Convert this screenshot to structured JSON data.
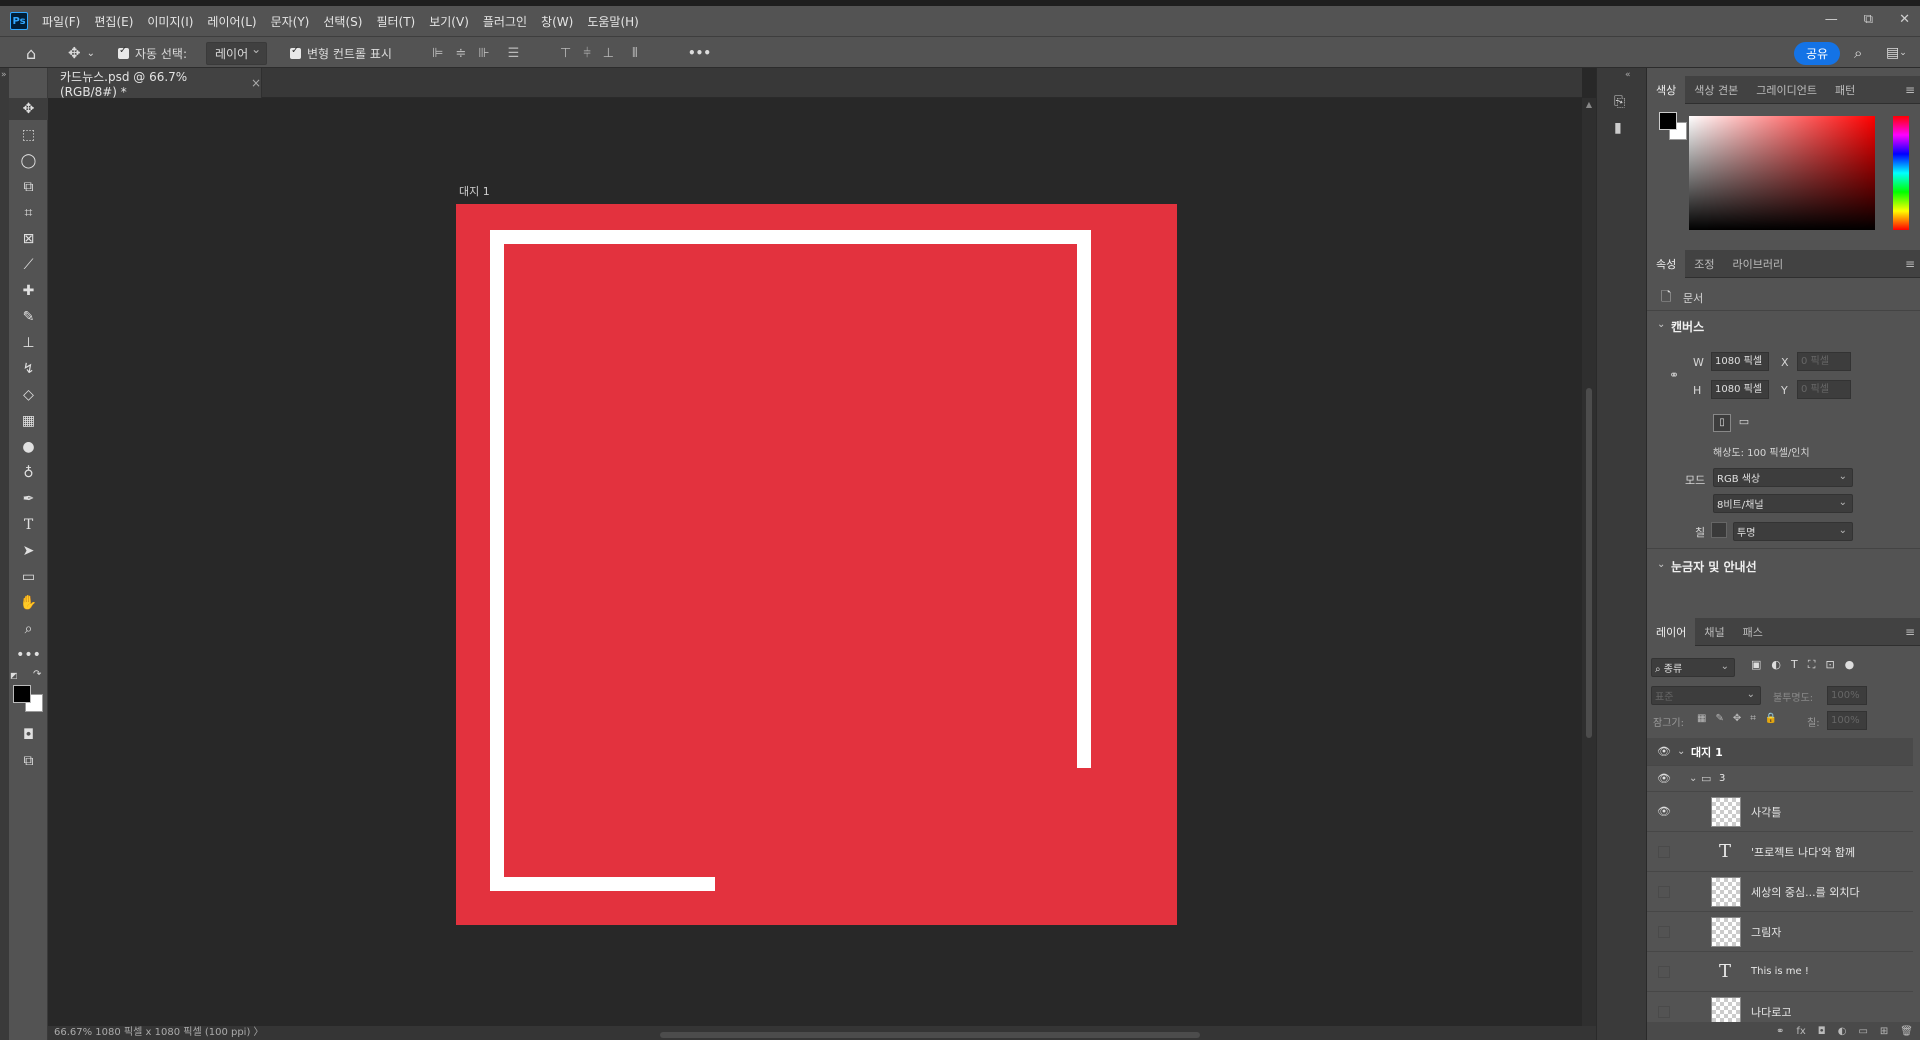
{
  "app": {
    "logo": "Ps"
  },
  "menu": [
    "파일(F)",
    "편집(E)",
    "이미지(I)",
    "레이어(L)",
    "문자(Y)",
    "선택(S)",
    "필터(T)",
    "보기(V)",
    "플러그인",
    "창(W)",
    "도움말(H)"
  ],
  "window_controls": [
    "—",
    "⧉",
    "✕"
  ],
  "options": {
    "auto_select_label": "자동 선택:",
    "auto_select_value": "레이어",
    "transform_label": "변형 컨트롤 표시",
    "more": "•••",
    "share": "공유"
  },
  "document": {
    "tab_title": "카드뉴스.psd @ 66.7% (RGB/8#) *",
    "tab_close": "×",
    "artboard_name": "대지 1",
    "artboard_color": "#e3323e",
    "status": "66.67%    1080 픽셀 x 1080 픽셀 (100 ppi)   〉"
  },
  "color_panel": {
    "tabs": [
      "색상",
      "색상 견본",
      "그레이디언트",
      "패턴"
    ],
    "hue_color": "#ff0000"
  },
  "properties_panel": {
    "tabs": [
      "속성",
      "조정",
      "라이브러리"
    ],
    "doc_label": "문서",
    "canvas_header": "캔버스",
    "w_label": "W",
    "w_value": "1080 픽셀",
    "h_label": "H",
    "h_value": "1080 픽셀",
    "x_label": "X",
    "x_placeholder": "0 픽셀",
    "y_label": "Y",
    "y_placeholder": "0 픽셀",
    "resolution": "해상도: 100 픽셀/인치",
    "mode_label": "모드",
    "mode_value": "RGB 색상",
    "depth_value": "8비트/채널",
    "fill_label": "칠",
    "fill_value": "투명",
    "rulers_header": "눈금자 및 안내선"
  },
  "layers_panel": {
    "tabs": [
      "레이어",
      "채널",
      "패스"
    ],
    "filter_value": "종류",
    "blend_value": "표준",
    "opacity_label": "불투명도:",
    "opacity_value": "100%",
    "lock_label": "잠그기:",
    "fill_label": "칠:",
    "fill_value": "100%",
    "layers": [
      {
        "name": "대지 1",
        "type": "artboard",
        "visible": true
      },
      {
        "name": "3",
        "type": "group",
        "visible": true
      },
      {
        "name": "사각틀",
        "type": "pixel",
        "visible": true
      },
      {
        "name": "'프로젝트 나다'와 함께",
        "type": "text",
        "visible": false
      },
      {
        "name": "세상의 중심...를 외치다",
        "type": "smart",
        "visible": false
      },
      {
        "name": "그림자",
        "type": "pixel",
        "visible": false
      },
      {
        "name": "This is me !",
        "type": "text",
        "visible": false
      },
      {
        "name": "나다로고",
        "type": "pixel",
        "visible": false
      }
    ]
  }
}
